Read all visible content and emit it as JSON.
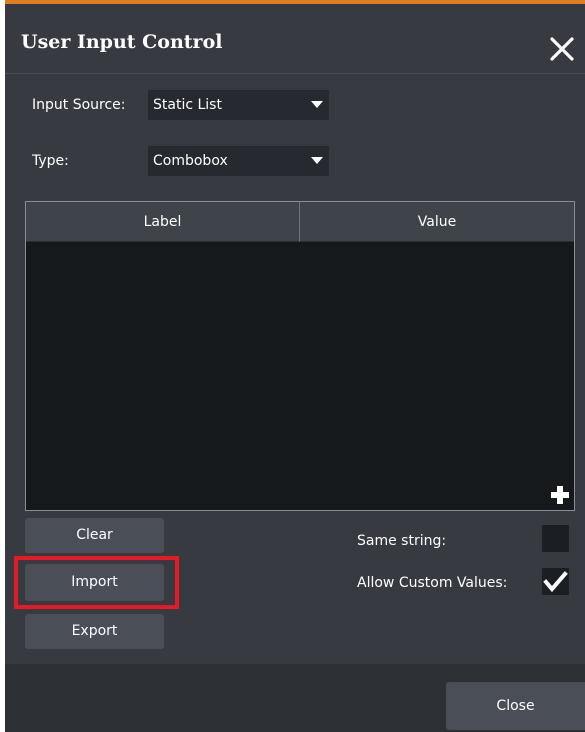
{
  "dialog": {
    "title": "User Input Control",
    "accent_color": "#e07f22"
  },
  "form": {
    "input_source": {
      "label": "Input Source:",
      "value": "Static List"
    },
    "type": {
      "label": "Type:",
      "value": "Combobox"
    }
  },
  "table": {
    "columns": [
      "Label",
      "Value"
    ],
    "rows": []
  },
  "buttons": {
    "clear": "Clear",
    "import": "Import",
    "export": "Export",
    "close": "Close"
  },
  "options": {
    "same_string": {
      "label": "Same string:",
      "checked": false
    },
    "allow_custom": {
      "label": "Allow Custom Values:",
      "checked": true
    }
  },
  "icons": {
    "close": "close-icon",
    "add": "plus-icon",
    "dropdown": "chevron-down-icon",
    "check": "check-icon"
  }
}
